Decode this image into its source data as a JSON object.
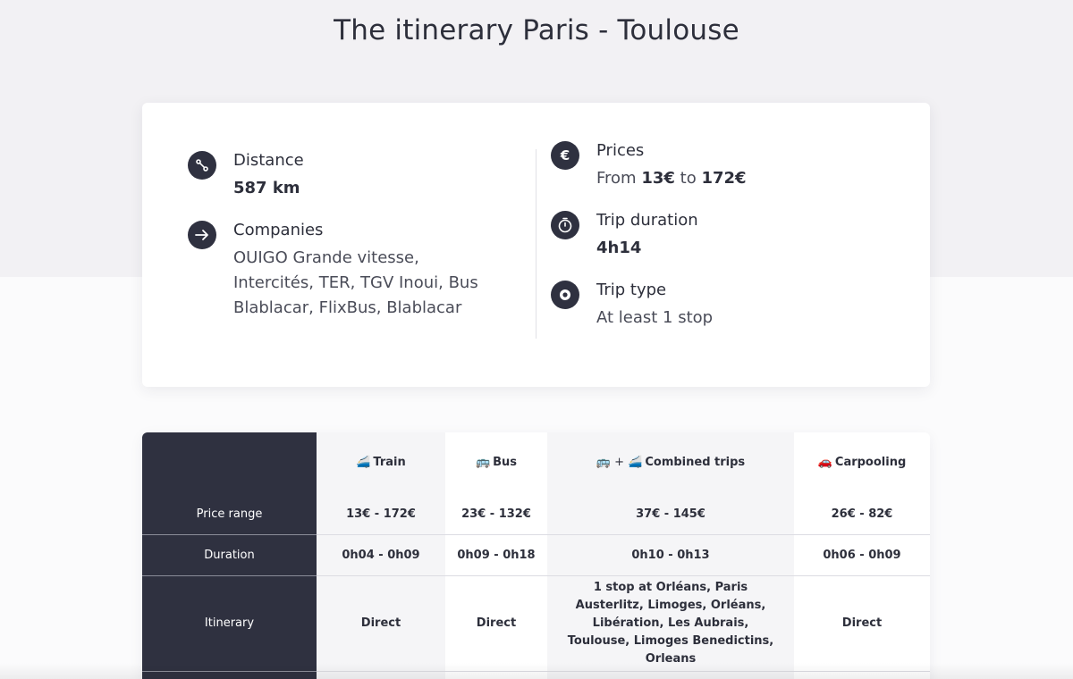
{
  "page": {
    "title": "The itinerary Paris - Toulouse"
  },
  "summary": {
    "distance": {
      "label": "Distance",
      "value": "587 km"
    },
    "companies": {
      "label": "Companies",
      "value": "OUIGO Grande vitesse, Intercités, TER, TGV Inoui, Bus Blablacar, FlixBus, Blablacar"
    },
    "prices": {
      "label": "Prices",
      "prefix": "From",
      "min": "13€",
      "joiner": "to",
      "max": "172€"
    },
    "duration": {
      "label": "Trip duration",
      "value": "4h14"
    },
    "trip_type": {
      "label": "Trip type",
      "value": "At least 1 stop"
    }
  },
  "icons": {
    "distance": "route-icon",
    "companies": "arrow-right-icon",
    "prices": "euro-icon",
    "duration": "stopwatch-icon",
    "trip_type": "map-pin-icon"
  },
  "table": {
    "columns": [
      {
        "icon": "🚄",
        "label": "Train"
      },
      {
        "icon": "🚌",
        "label": "Bus"
      },
      {
        "icon": "🚌 + 🚄",
        "label": "Combined trips"
      },
      {
        "icon": "🚗",
        "label": "Carpooling"
      }
    ],
    "rows": {
      "price": {
        "label": "Price range",
        "cells": [
          "13€ - 172€",
          "23€ - 132€",
          "37€ - 145€",
          "26€ - 82€"
        ]
      },
      "duration": {
        "label": "Duration",
        "cells": [
          "0h04 - 0h09",
          "0h09 - 0h18",
          "0h10 - 0h13",
          "0h06 - 0h09"
        ]
      },
      "itinerary": {
        "label": "Itinerary",
        "cells": [
          "Direct",
          "Direct",
          "1 stop at Orléans, Paris Austerlitz, Limoges, Orléans, Libération, Les Aubrais, Toulouse, Limoges Benedictins, Orleans",
          "Direct"
        ]
      }
    }
  },
  "colors": {
    "dark": "#2f3140",
    "text": "#2d2f3b",
    "band": "#f2f1f4"
  }
}
